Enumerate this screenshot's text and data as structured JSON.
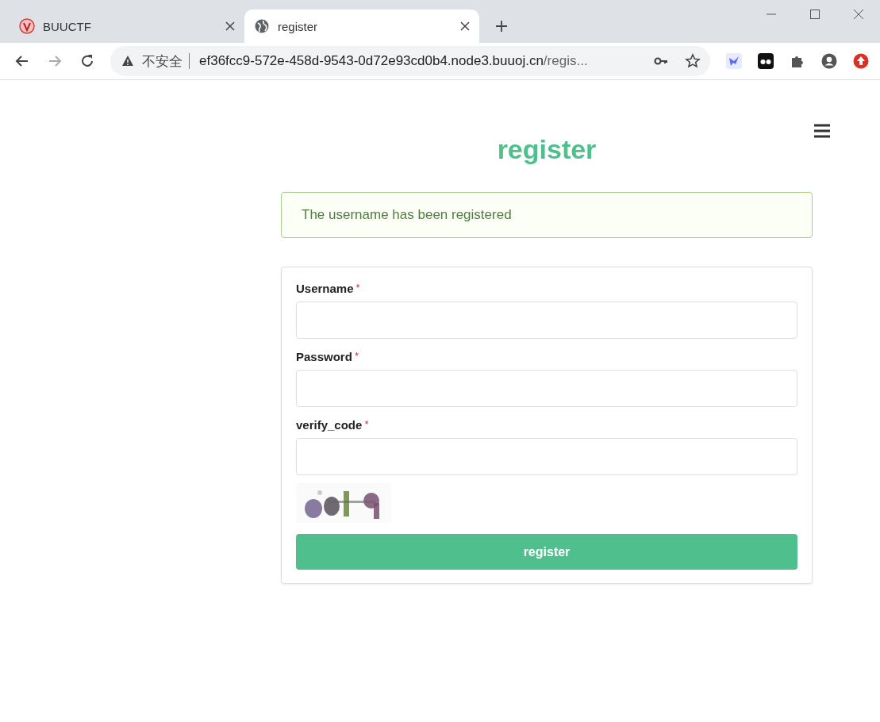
{
  "browser": {
    "tabs": [
      {
        "title": "BUUCTF",
        "selected": false,
        "kind": "site"
      },
      {
        "title": "register",
        "selected": true,
        "kind": "globe"
      }
    ],
    "address": {
      "security": "不安全",
      "host": "ef36fcc9-572e-458d-9543-0d72e93cd0b4.node3.buuoj.cn",
      "path": "/regis..."
    }
  },
  "page": {
    "title": "register",
    "alert": "The username has been registered",
    "fields": [
      {
        "label": "Username",
        "required_mark": "*"
      },
      {
        "label": "Password",
        "required_mark": "*"
      },
      {
        "label": "verify_code",
        "required_mark": "*"
      }
    ],
    "submit": "register"
  }
}
